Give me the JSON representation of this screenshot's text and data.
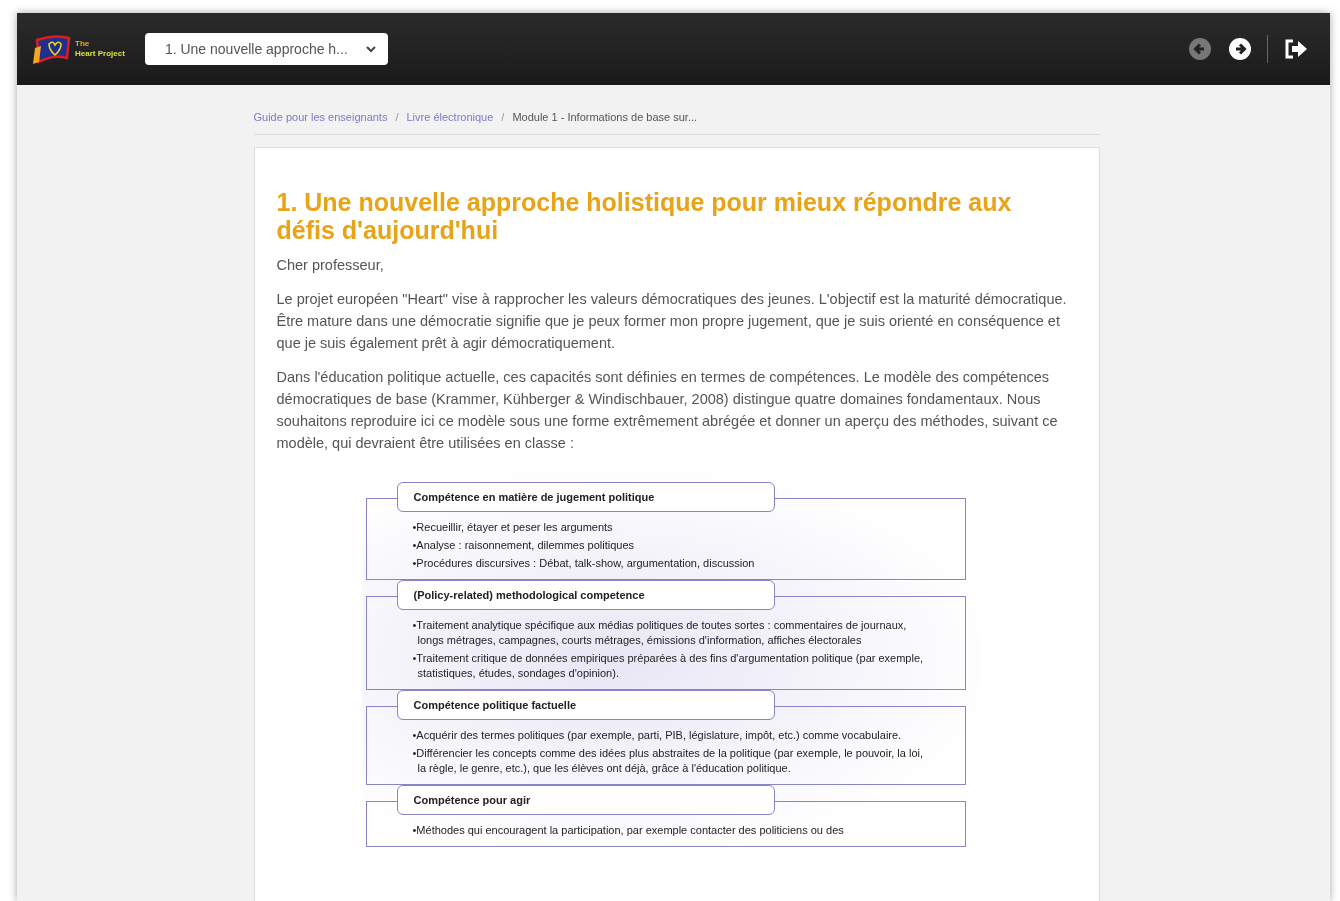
{
  "header": {
    "logo": {
      "line_1": "The",
      "line_2": "Heart Project"
    },
    "chapter_select": {
      "value": "1. Une nouvelle approche h..."
    },
    "buttons": [
      {
        "kind": "previous",
        "disabled": true
      },
      {
        "kind": "next",
        "disabled": false
      },
      {
        "kind": "exit",
        "disabled": false
      }
    ]
  },
  "breadcrumb": [
    {
      "label": "Guide pour les enseignants",
      "link": true
    },
    {
      "separator": "/",
      "label": "Livre électronique",
      "link": true
    },
    {
      "separator": "/",
      "label": "Module 1 - Informations de base sur...",
      "link": false
    }
  ],
  "article": {
    "title": "1.  Une nouvelle approche holistique pour mieux répondre aux défis d'aujourd'hui",
    "paragraphs": [
      "Cher professeur,",
      "Le projet européen \"Heart\" vise à rapprocher les valeurs démocratiques des jeunes. L'objectif est la maturité démocratique. Être mature dans une démocratie signifie que je peux former mon propre jugement, que je suis orienté en conséquence et que je suis également prêt à agir démocratiquement.",
      "Dans l'éducation politique actuelle, ces capacités sont définies en termes de compétences. Le modèle des compétences démocratiques de base (Krammer, Kühberger & Windischbauer, 2008) distingue quatre domaines fondamentaux. Nous souhaitons reproduire ici ce modèle sous une forme extrêmement abrégée et donner un aperçu des méthodes, suivant ce modèle, qui devraient être utilisées en classe :"
    ],
    "diagram": [
      {
        "heading": "Compétence en matière de jugement politique",
        "items": [
          "•Recueillir, étayer et peser les arguments",
          "•Analyse : raisonnement, dilemmes politiques",
          "•Procédures discursives : Débat, talk-show, argumentation, discussion"
        ]
      },
      {
        "heading": "(Policy-related) methodological competence",
        "items": [
          "•Traitement analytique spécifique aux médias politiques de toutes sortes : commentaires de journaux, longs métrages, campagnes, courts métrages, émissions d'information, affiches électorales",
          "•Traitement critique de données empiriques préparées à des fins d'argumentation politique (par exemple, statistiques, études, sondages d'opinion)."
        ]
      },
      {
        "heading": "Compétence politique factuelle",
        "items": [
          "•Acquérir des termes politiques (par exemple, parti, PIB, législature, impôt, etc.) comme vocabulaire.",
          "•Différencier les concepts comme des idées plus abstraites de la politique (par exemple, le pouvoir, la loi, la règle, le genre, etc.), que les élèves ont déjà, grâce à l'éducation politique."
        ]
      },
      {
        "heading": "Compétence pour agir",
        "items": [
          "•Méthodes qui encouragent la participation, par exemple contacter des politiciens ou des"
        ]
      }
    ]
  }
}
